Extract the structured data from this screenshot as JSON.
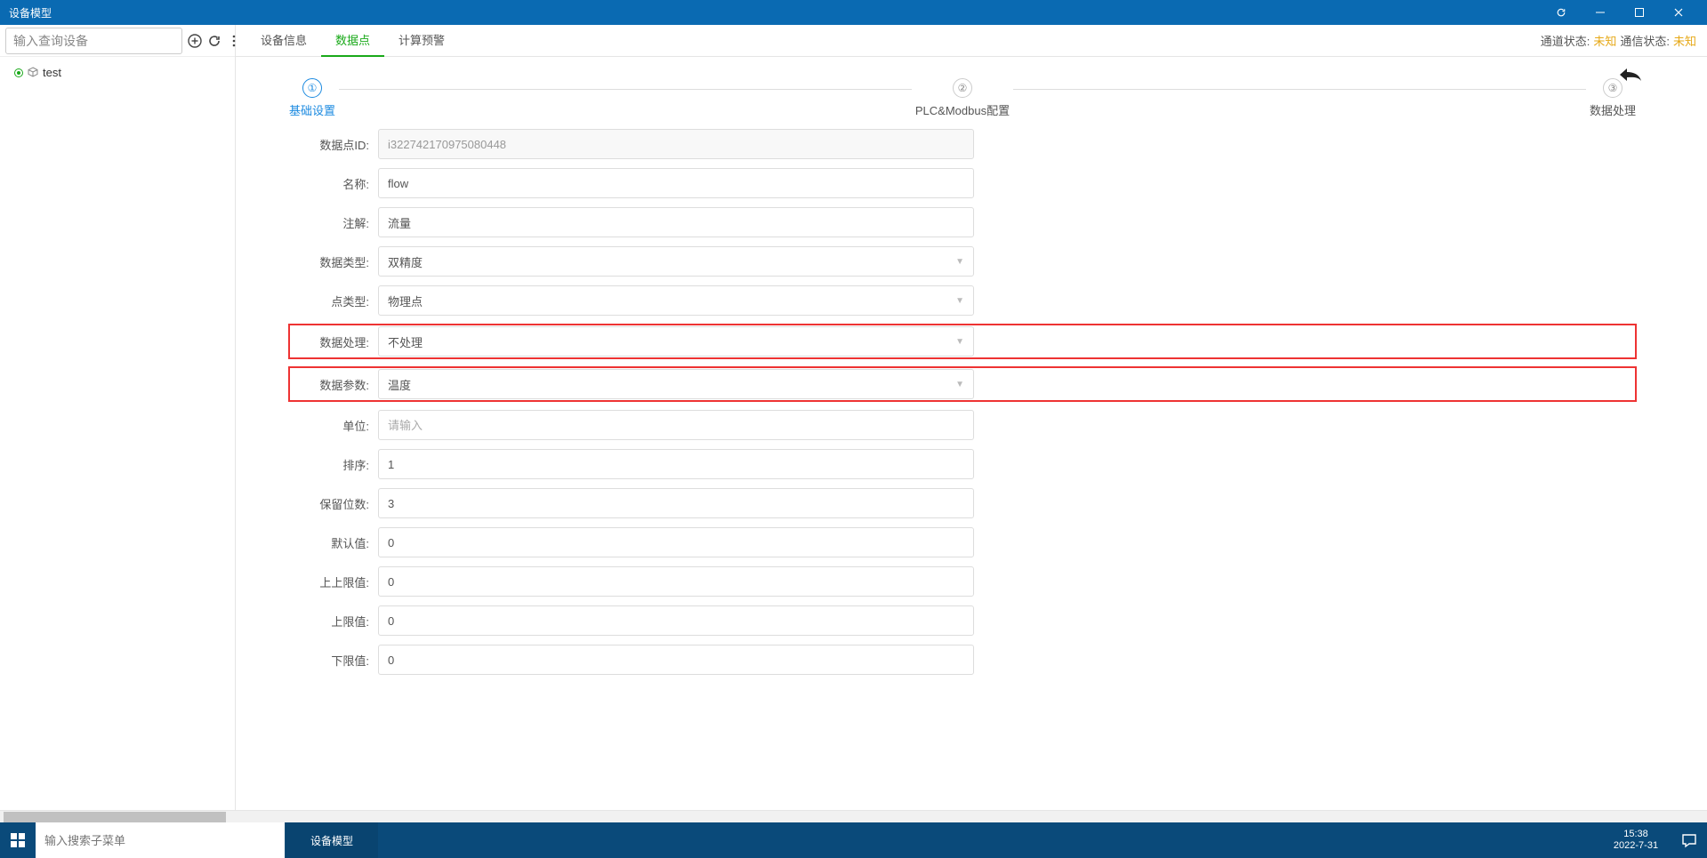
{
  "titlebar": {
    "title": "设备模型"
  },
  "sidebar": {
    "search_placeholder": "输入查询设备",
    "tree": {
      "item0": "test"
    }
  },
  "tabs": {
    "t0": "设备信息",
    "t1": "数据点",
    "t2": "计算预警"
  },
  "status": {
    "channel_label": "通道状态:",
    "channel_value": "未知",
    "comm_label": "通信状态:",
    "comm_value": "未知"
  },
  "steps": {
    "s1_num": "①",
    "s1_label": "基础设置",
    "s2_num": "②",
    "s2_label": "PLC&Modbus配置",
    "s3_num": "③",
    "s3_label": "数据处理"
  },
  "form": {
    "id_label": "数据点ID:",
    "id_value": "i322742170975080448",
    "name_label": "名称:",
    "name_value": "flow",
    "note_label": "注解:",
    "note_value": "流量",
    "dtype_label": "数据类型:",
    "dtype_value": "双精度",
    "ptype_label": "点类型:",
    "ptype_value": "物理点",
    "proc_label": "数据处理:",
    "proc_value": "不处理",
    "param_label": "数据参数:",
    "param_value": "温度",
    "unit_label": "单位:",
    "unit_placeholder": "请输入",
    "sort_label": "排序:",
    "sort_value": "1",
    "keep_label": "保留位数:",
    "keep_value": "3",
    "def_label": "默认值:",
    "def_value": "0",
    "hh_label": "上上限值:",
    "hh_value": "0",
    "hi_label": "上限值:",
    "hi_value": "0",
    "lo_label": "下限值:",
    "lo_value": "0"
  },
  "taskbar": {
    "search_placeholder": "输入搜索子菜单",
    "active_task": "设备模型",
    "time": "15:38",
    "date": "2022-7-31"
  }
}
